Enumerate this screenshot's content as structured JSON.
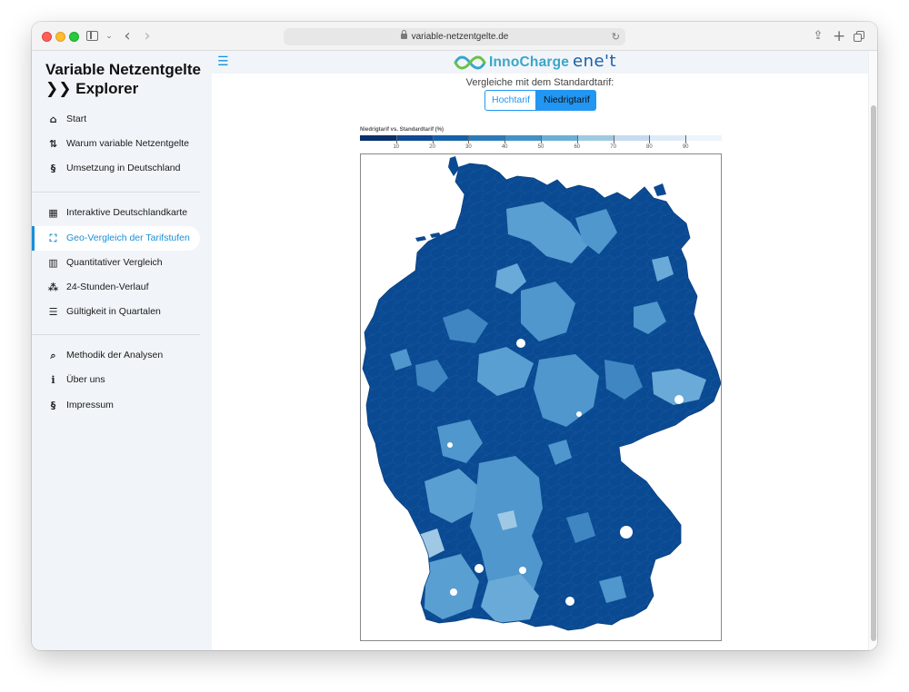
{
  "browser": {
    "url": "variable-netzentgelte.de"
  },
  "sidebar": {
    "app_title_line1": "Variable Netzentgelte",
    "app_title_line2": "Explorer",
    "items": [
      {
        "label": "Start",
        "icon": "home-icon"
      },
      {
        "label": "Warum variable Netzentgelte",
        "icon": "arrows-exchange-icon"
      },
      {
        "label": "Umsetzung in Deutschland",
        "icon": "paragraph-icon"
      },
      {
        "label": "Interaktive Deutschlandkarte",
        "icon": "map-icon"
      },
      {
        "label": "Geo-Vergleich der Tarifstufen",
        "icon": "frame-corners-icon",
        "active": true
      },
      {
        "label": "Quantitativer Vergleich",
        "icon": "bar-chart-icon"
      },
      {
        "label": "24-Stunden-Verlauf",
        "icon": "timeline-icon"
      },
      {
        "label": "Gültigkeit in Quartalen",
        "icon": "list-icon"
      },
      {
        "label": "Methodik der Analysen",
        "icon": "magnifier-icon"
      },
      {
        "label": "Über uns",
        "icon": "info-icon"
      },
      {
        "label": "Impressum",
        "icon": "paragraph-icon"
      }
    ]
  },
  "header": {
    "logo_innocharge": "InnoCharge",
    "logo_enet": "ene't"
  },
  "compare": {
    "label": "Vergleiche mit dem Standardtarif:",
    "btn_hoch": "Hochtarif",
    "btn_niedrig": "Niedrigtarif",
    "selected": "Niedrigtarif"
  },
  "legend": {
    "title": "Niedrigtarif vs. Standardtarif (%)",
    "ticks": [
      "10",
      "20",
      "30",
      "40",
      "50",
      "60",
      "70",
      "80",
      "90"
    ],
    "colors": [
      "#08306b",
      "#0c4a92",
      "#1561a9",
      "#2b7bba",
      "#4292c6",
      "#6baed6",
      "#9ecae1",
      "#c6dbef",
      "#deebf7",
      "#eef4fb"
    ]
  },
  "map": {
    "dominant_color": "#0a4a92",
    "secondary_color": "#4f97cc",
    "light_color": "#9fc8e4"
  }
}
